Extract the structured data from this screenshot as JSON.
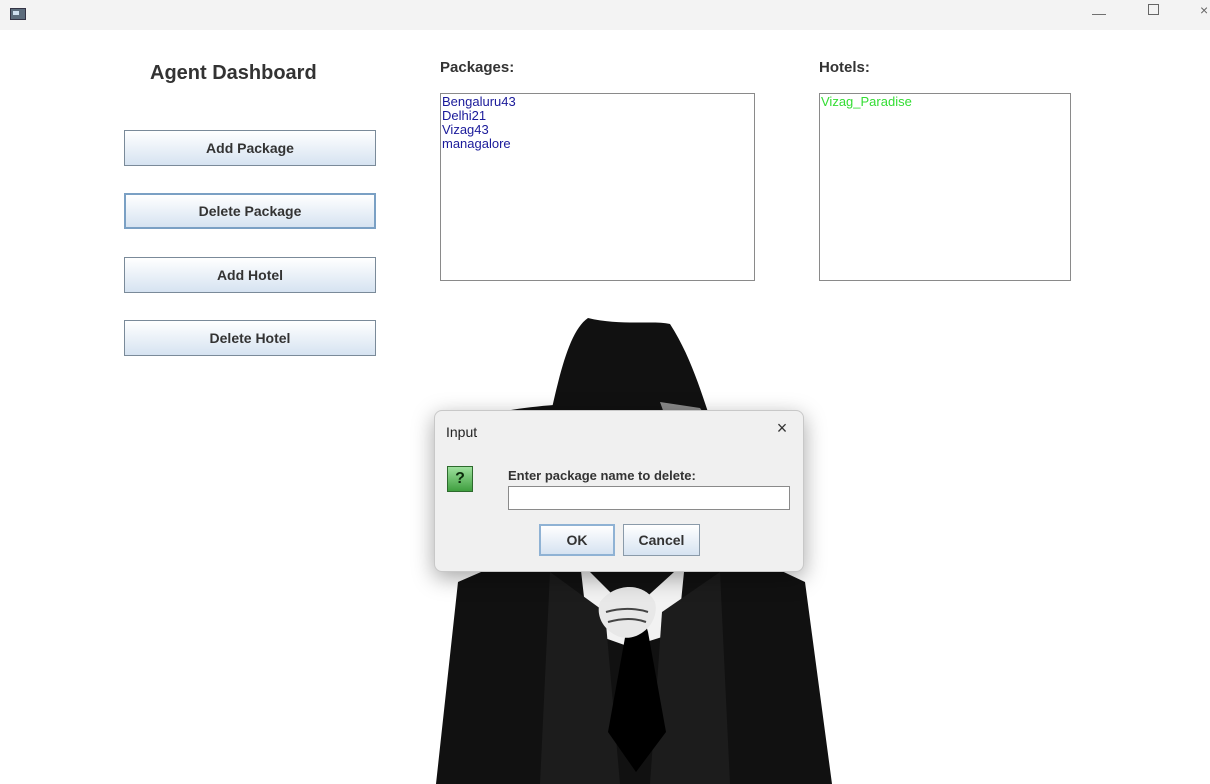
{
  "window": {
    "min_glyph": "—",
    "close_glyph": "×"
  },
  "dashboard": {
    "title": "Agent Dashboard",
    "buttons": {
      "add_package": "Add Package",
      "delete_package": "Delete Package",
      "add_hotel": "Add Hotel",
      "delete_hotel": "Delete Hotel"
    }
  },
  "packages": {
    "label": "Packages:",
    "items": [
      "Bengaluru43",
      "Delhi21",
      "Vizag43",
      "managalore"
    ],
    "text_color": "#1a1a9a"
  },
  "hotels": {
    "label": "Hotels:",
    "items": [
      "Vizag_Paradise"
    ],
    "text_color": "#33dd33"
  },
  "dialog": {
    "title": "Input",
    "close_glyph": "×",
    "icon": "question-icon",
    "icon_glyph": "?",
    "prompt": "Enter package name to delete:",
    "input_value": "",
    "ok_label": "OK",
    "cancel_label": "Cancel"
  }
}
